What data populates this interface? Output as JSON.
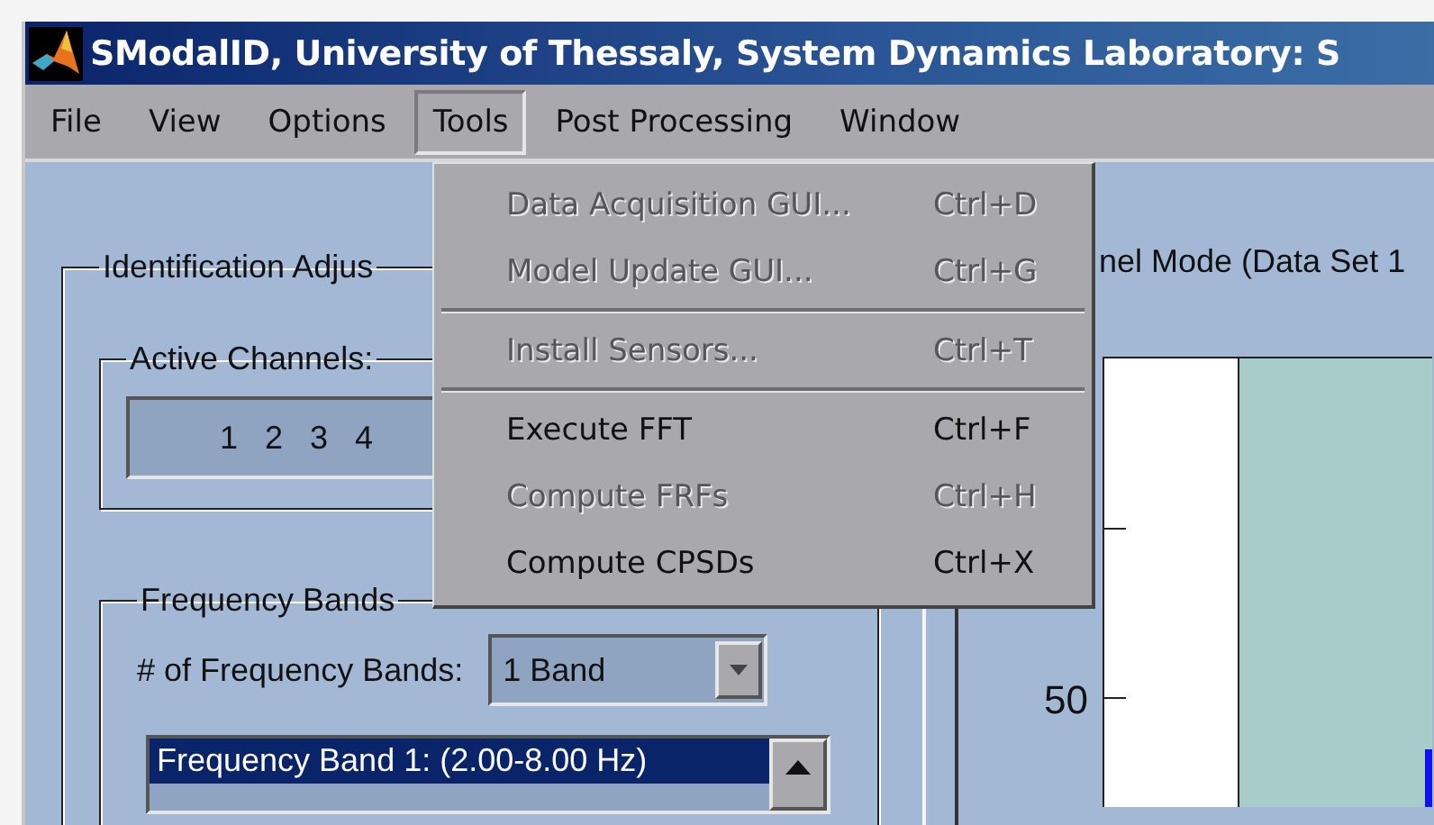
{
  "window": {
    "title": "SModalID, University of Thessaly, System Dynamics Laboratory: S"
  },
  "menu_bar": [
    {
      "label": "File",
      "selected": false
    },
    {
      "label": "View",
      "selected": false
    },
    {
      "label": "Options",
      "selected": false
    },
    {
      "label": "Tools",
      "selected": true
    },
    {
      "label": "Post Processing",
      "selected": false
    },
    {
      "label": "Window",
      "selected": false
    }
  ],
  "tools_menu": [
    {
      "label": "Data Acquisition GUI...",
      "shortcut": "Ctrl+D",
      "disabled": true,
      "separator_after": false
    },
    {
      "label": "Model Update GUI...",
      "shortcut": "Ctrl+G",
      "disabled": true,
      "separator_after": true
    },
    {
      "label": "Install Sensors...",
      "shortcut": "Ctrl+T",
      "disabled": true,
      "separator_after": true
    },
    {
      "label": "Execute FFT",
      "shortcut": "Ctrl+F",
      "disabled": false,
      "separator_after": false
    },
    {
      "label": "Compute FRFs",
      "shortcut": "Ctrl+H",
      "disabled": true,
      "separator_after": false
    },
    {
      "label": "Compute CPSDs",
      "shortcut": "Ctrl+X",
      "disabled": false,
      "separator_after": false
    }
  ],
  "identification_panel": {
    "title": "Identification Adjus",
    "active_channels": {
      "title": "Active Channels:",
      "channels": [
        "1",
        "2",
        "3",
        "4"
      ]
    },
    "frequency_bands": {
      "title": "Frequency Bands",
      "count_label": "# of Frequency Bands:",
      "count_value": "1 Band",
      "bands": [
        {
          "label": "Frequency Band 1: (2.00-8.00 Hz)",
          "selected": true
        }
      ]
    }
  },
  "plot_panel": {
    "title": "nel Mode (Data Set 1",
    "y_tick_label": "50"
  }
}
